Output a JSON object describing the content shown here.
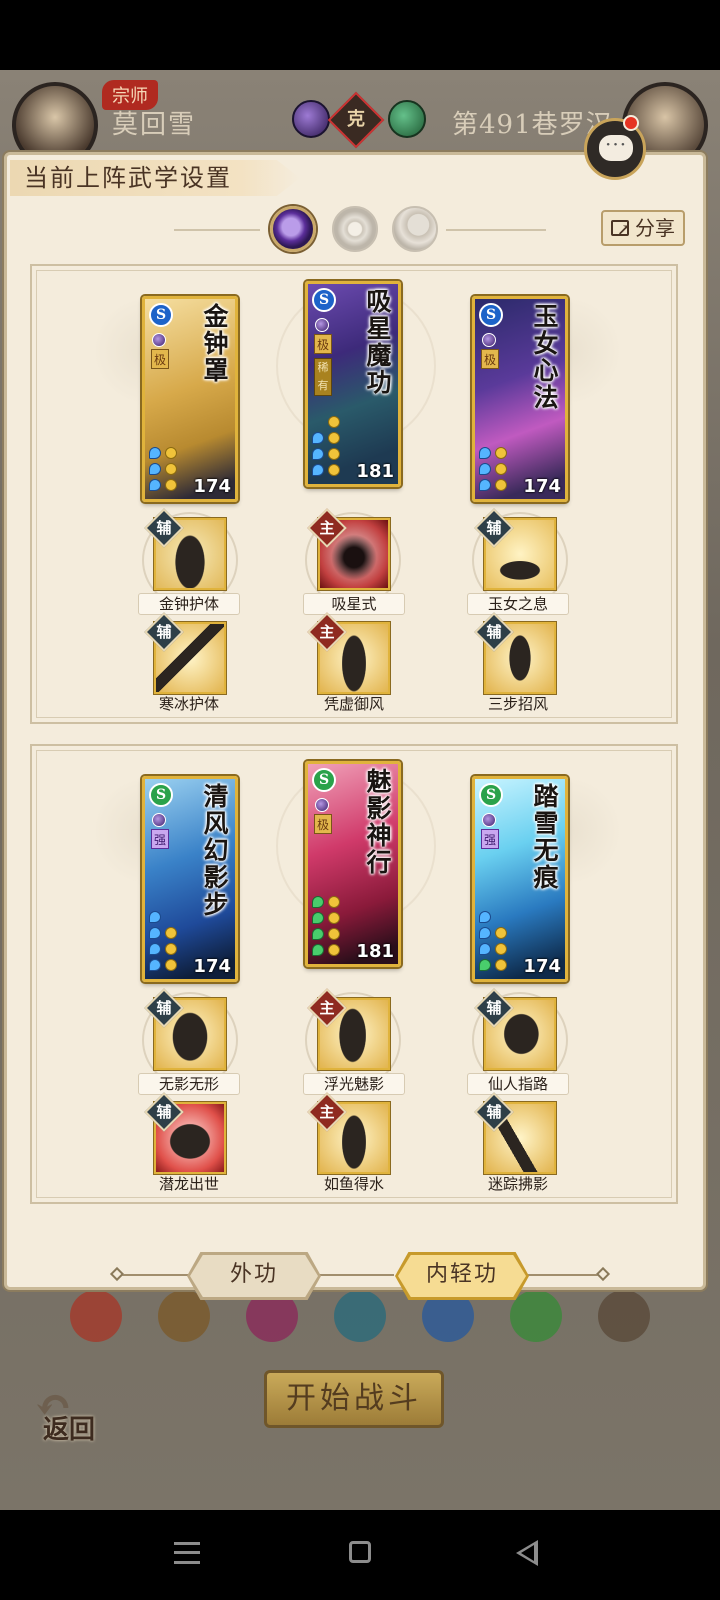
{
  "header": {
    "master_tag": "宗师",
    "player_name": "莫回雪",
    "vs_label": "克",
    "opponent_name": "第491巷罗汉"
  },
  "panel": {
    "title": "当前上阵武学设置",
    "share_label": "分享",
    "tabs": [
      {
        "name": "moon-orb-tab",
        "active": true
      },
      {
        "name": "sun-orb-tab",
        "active": false
      },
      {
        "name": "crescent-orb-tab",
        "active": false
      }
    ]
  },
  "sections": [
    {
      "cards": [
        {
          "name": "金钟罩",
          "type": "S",
          "grade": "极",
          "level": "174",
          "color": "gold"
        },
        {
          "name": "吸星魔功",
          "type": "S",
          "grade": "极",
          "sub_tag": "稀有",
          "level": "181",
          "color": "purple"
        },
        {
          "name": "玉女心法",
          "type": "S",
          "grade": "极",
          "level": "174",
          "color": "violet"
        }
      ],
      "subs_row1": [
        {
          "role": "辅",
          "label": "金钟护体"
        },
        {
          "role": "主",
          "label": "吸星式"
        },
        {
          "role": "辅",
          "label": "玉女之息"
        }
      ],
      "subs_row2": [
        {
          "role": "辅",
          "label": "寒冰护体"
        },
        {
          "role": "主",
          "label": "凭虚御风"
        },
        {
          "role": "辅",
          "label": "三步招风"
        }
      ]
    },
    {
      "cards": [
        {
          "name": "清风幻影步",
          "type": "S",
          "grade": "强",
          "level": "174",
          "color": "blue"
        },
        {
          "name": "魅影神行",
          "type": "S",
          "grade": "极",
          "level": "181",
          "color": "crimson"
        },
        {
          "name": "踏雪无痕",
          "type": "S",
          "grade": "强",
          "level": "174",
          "color": "ice"
        }
      ],
      "subs_row1": [
        {
          "role": "辅",
          "label": "无影无形"
        },
        {
          "role": "主",
          "label": "浮光魅影"
        },
        {
          "role": "辅",
          "label": "仙人指路"
        }
      ],
      "subs_row2": [
        {
          "role": "辅",
          "label": "潜龙出世"
        },
        {
          "role": "主",
          "label": "如鱼得水"
        },
        {
          "role": "辅",
          "label": "迷踪拂影"
        }
      ]
    }
  ],
  "bottom_tabs": {
    "outer": "外功",
    "inner": "内轻功",
    "active": "inner"
  },
  "footer": {
    "back_label": "返回",
    "start_label": "开始战斗"
  },
  "colors": {
    "accent_gold": "#e0b33c",
    "aux_badge": "#2e3f48",
    "main_badge": "#8f2a20",
    "panel_bg": "#f4ecdc"
  }
}
